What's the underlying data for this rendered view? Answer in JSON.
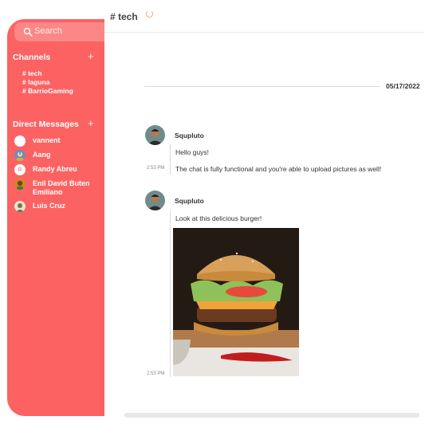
{
  "header": {
    "channel": "# tech"
  },
  "search": {
    "placeholder": "Search"
  },
  "channels": {
    "title": "Channels",
    "items": [
      "# tech",
      "# laguna",
      "# BarrioGaming"
    ]
  },
  "direct_messages": {
    "title": "Direct Messages",
    "items": [
      {
        "name": "vannent",
        "avatar": ""
      },
      {
        "name": "Aang",
        "avatar": ""
      },
      {
        "name": "Randy Abreu",
        "avatar": "R"
      },
      {
        "name": "Enil David Buten Emiliano",
        "avatar": ""
      },
      {
        "name": "Luis Cruz",
        "avatar": ""
      }
    ]
  },
  "date_divider": "05/17/2022",
  "messages": [
    {
      "author": "Squpluto",
      "lines": [
        {
          "text": "Hello guys!",
          "time": ""
        },
        {
          "text": "The chat is fully functional and you're able to upload pictures as well!",
          "time": "2:53 PM"
        }
      ]
    },
    {
      "author": "Squpluto",
      "lines": [
        {
          "text": "Look at this delicious burger!",
          "time": ""
        },
        {
          "text": "",
          "time": "2:53 PM"
        }
      ]
    }
  ],
  "colors": {
    "sidebar": "#fc6262",
    "accent": "#f4a46a"
  }
}
